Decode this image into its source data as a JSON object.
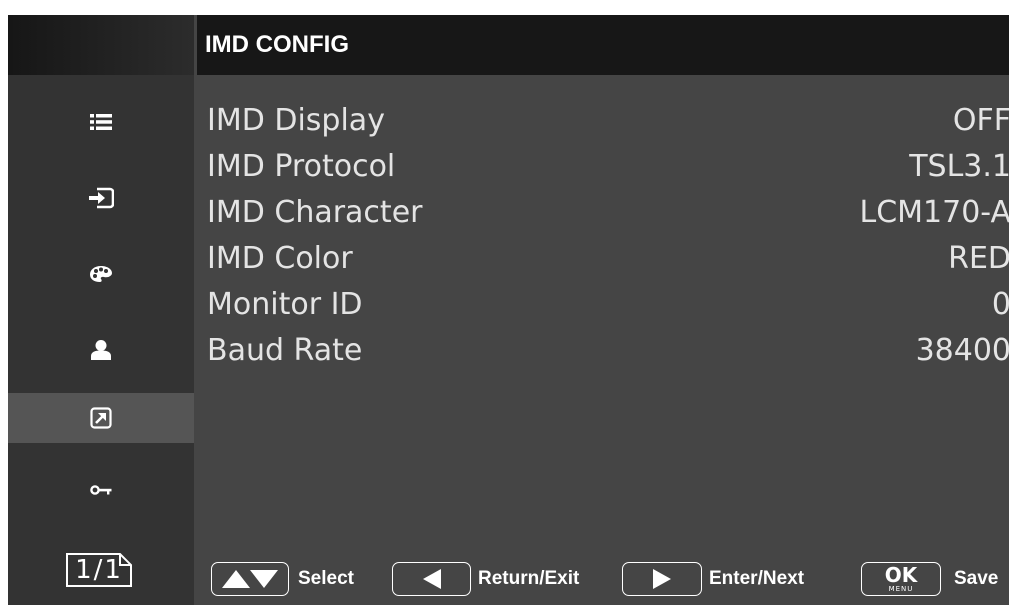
{
  "header": {
    "title": "IMD CONFIG"
  },
  "sidebar": {
    "items": [
      {
        "icon": "list-icon",
        "active": false
      },
      {
        "icon": "input-source-icon",
        "active": false
      },
      {
        "icon": "color-palette-icon",
        "active": false
      },
      {
        "icon": "user-icon",
        "active": false
      },
      {
        "icon": "shortcut-icon",
        "active": true
      },
      {
        "icon": "key-icon",
        "active": false
      }
    ],
    "page": "1/1"
  },
  "settings": [
    {
      "label": "IMD Display",
      "value": "OFF"
    },
    {
      "label": "IMD Protocol",
      "value": "TSL3.1"
    },
    {
      "label": "IMD Character",
      "value": "LCM170-A"
    },
    {
      "label": "IMD Color",
      "value": "RED"
    },
    {
      "label": "Monitor ID",
      "value": "0"
    },
    {
      "label": "Baud Rate",
      "value": "38400"
    }
  ],
  "footer": {
    "select_label": "Select",
    "return_label": "Return/Exit",
    "enter_label": "Enter/Next",
    "save_label": "Save",
    "ok_text": "OK",
    "menu_text": "MENU"
  },
  "colors": {
    "background": "#454545",
    "sidebar": "#333333",
    "header": "#171717",
    "active_item": "#555555",
    "text": "#e4e4e4"
  }
}
